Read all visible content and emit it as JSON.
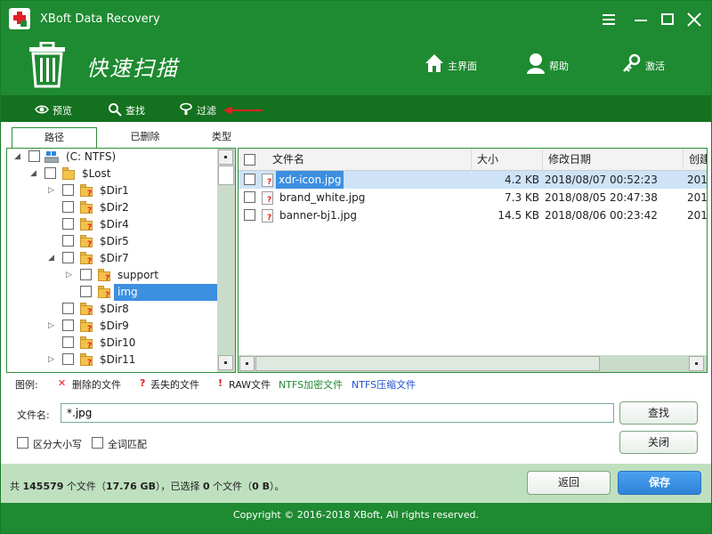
{
  "app": {
    "title": "XBoft Data Recovery"
  },
  "header": {
    "page_title": "快速扫描",
    "links": {
      "home": "主界面",
      "help": "帮助",
      "activate": "激活"
    }
  },
  "toolbar": {
    "preview": "预览",
    "find": "查找",
    "filter": "过滤"
  },
  "tabs": [
    "路径",
    "已删除",
    "类型"
  ],
  "tree": {
    "drive": "(C: NTFS)",
    "root": "$Lost",
    "items": [
      "$Dir1",
      "$Dir2",
      "$Dir4",
      "$Dir5",
      "$Dir7",
      "support",
      "img",
      "$Dir8",
      "$Dir9",
      "$Dir10",
      "$Dir11"
    ]
  },
  "list": {
    "columns": {
      "name": "文件名",
      "size": "大小",
      "modified": "修改日期",
      "created": "创建"
    },
    "rows": [
      {
        "name": "xdr-icon.jpg",
        "size": "4.2 KB",
        "modified": "2018/08/07 00:52:23",
        "created": "201"
      },
      {
        "name": "brand_white.jpg",
        "size": "7.3 KB",
        "modified": "2018/08/05 20:47:38",
        "created": "201"
      },
      {
        "name": "banner-bj1.jpg",
        "size": "14.5 KB",
        "modified": "2018/08/06 00:23:42",
        "created": "201"
      }
    ]
  },
  "legend": {
    "title": "图例:",
    "deleted": "删除的文件",
    "lost": "丢失的文件",
    "raw": "RAW文件",
    "ntfs_encrypted": "NTFS加密文件",
    "ntfs_compressed": "NTFS压缩文件",
    "colors": {
      "deleted_mark": "#e02020",
      "encrypted": "#1e8a31",
      "compressed": "#1f4fd0"
    }
  },
  "search": {
    "filename_label": "文件名:",
    "filename_value": "*.jpg",
    "find_button": "查找",
    "close_button": "关闭",
    "case_sensitive": "区分大小写",
    "whole_word": "全词匹配"
  },
  "status": {
    "prefix": "共 ",
    "total_count": "145579",
    "mid1": " 个文件（",
    "total_size": "17.76 GB",
    "mid2": "），已选择 ",
    "selected_count": "0",
    "mid3": " 个文件（",
    "selected_size": "0 B",
    "suffix": "）。",
    "back_button": "返回",
    "save_button": "保存"
  },
  "footer": {
    "copyright": "Copyright © 2016-2018 XBoft, All rights reserved."
  },
  "colors": {
    "brand_green": "#1e8a31",
    "toolbar_green": "#14711f",
    "selection_blue": "#3d8fe0",
    "status_green": "#bfe0bf"
  }
}
